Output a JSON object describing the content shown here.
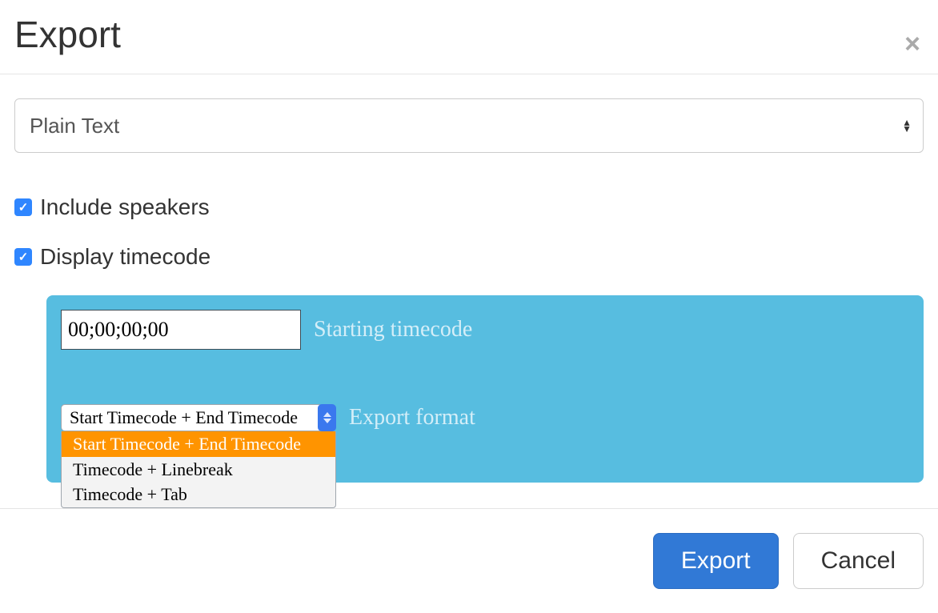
{
  "header": {
    "title": "Export",
    "close_icon": "×"
  },
  "format_select": {
    "value": "Plain Text"
  },
  "options": {
    "include_speakers": {
      "checked": true,
      "label": "Include speakers"
    },
    "display_timecode": {
      "checked": true,
      "label": "Display timecode"
    }
  },
  "timecode_panel": {
    "starting_value": "00;00;00;00",
    "starting_label": "Starting timecode",
    "export_format_label": "Export format",
    "export_format_selected": "Start Timecode + End Timecode",
    "export_format_options": [
      {
        "label": "Start Timecode + End Timecode",
        "selected": true
      },
      {
        "label": "Timecode + Linebreak",
        "selected": false
      },
      {
        "label": "Timecode + Tab",
        "selected": false
      }
    ]
  },
  "footer": {
    "export_label": "Export",
    "cancel_label": "Cancel"
  }
}
